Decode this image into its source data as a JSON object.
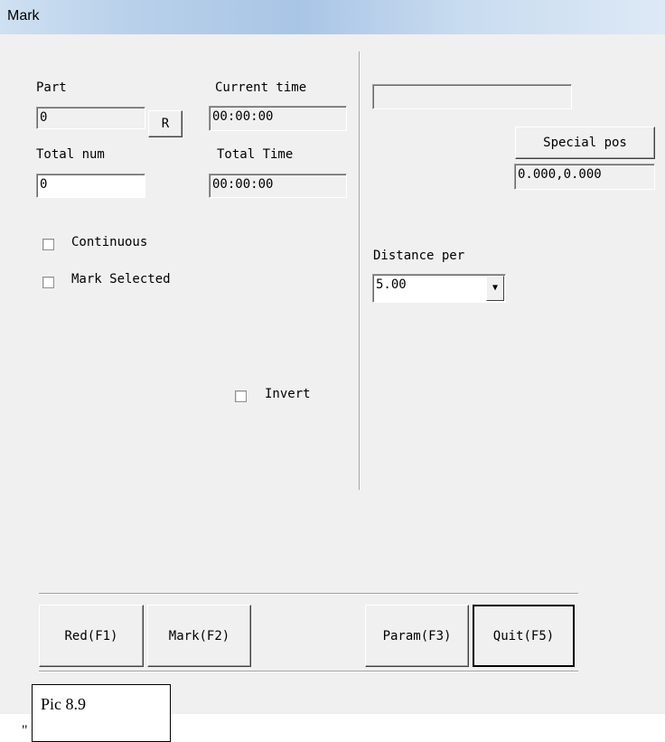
{
  "window": {
    "title": "Mark"
  },
  "left": {
    "part_label": "Part",
    "part_value": "0",
    "r_button": "R",
    "current_time_label": "Current time",
    "current_time_value": "00:00:00",
    "total_num_label": "Total num",
    "total_num_value": "0",
    "total_time_label": "Total Time",
    "total_time_value": "00:00:00",
    "continuous_label": "Continuous",
    "continuous_checked": false,
    "mark_selected_label": "Mark Selected",
    "mark_selected_checked": false,
    "invert_label": "Invert",
    "invert_checked": false
  },
  "right": {
    "top_field_value": "",
    "special_pos_button": "Special pos",
    "special_pos_value": "0.000,0.000",
    "distance_label": "Distance per",
    "distance_value": "5.00"
  },
  "buttons": {
    "red": "Red(F1)",
    "mark": "Mark(F2)",
    "param": "Param(F3)",
    "quit": "Quit(F5)"
  },
  "caption": {
    "text": "Pic 8.9",
    "quote_mark": "\""
  }
}
